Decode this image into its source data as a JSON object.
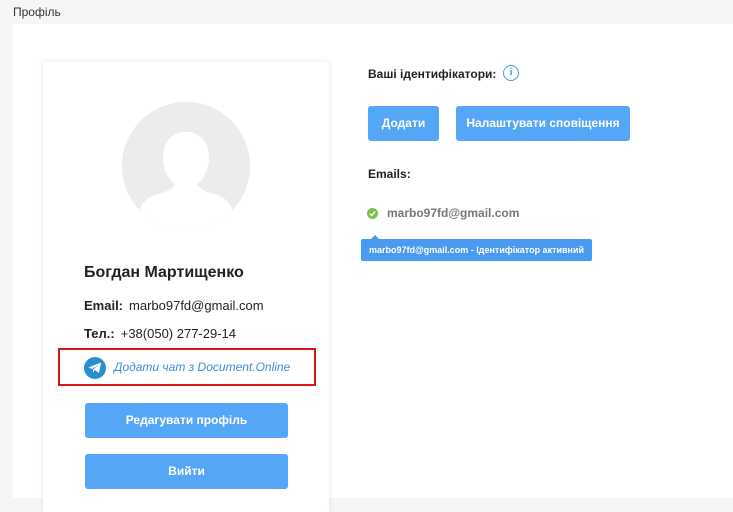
{
  "header": {
    "title": "Профіль"
  },
  "profile": {
    "name": "Богдан Мартищенко",
    "email_label": "Email:",
    "email_value": "marbo97fd@gmail.com",
    "phone_label": "Тел.:",
    "phone_value": "+38(050) 277-29-14",
    "telegram_link": "Додати чат з Document.Online",
    "edit_button": "Редагувати профіль",
    "logout_button": "Вийти"
  },
  "identifiers": {
    "title": "Ваші ідентифікатори:",
    "add_button": "Додати",
    "notify_button": "Налаштувати сповіщення",
    "emails_label": "Emails:",
    "emails": [
      {
        "address": "marbo97fd@gmail.com",
        "status": "active"
      }
    ],
    "tooltip": "marbo97fd@gmail.com - Ідентифікатор активний"
  },
  "colors": {
    "accent": "#55a6f6",
    "highlight_border": "#d9141c",
    "status_active": "#7cc04b",
    "link": "#3a8fd8"
  }
}
